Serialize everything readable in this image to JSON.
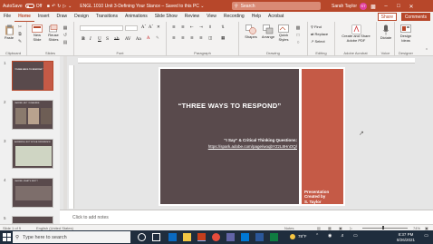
{
  "titlebar": {
    "autosave_label": "AutoSave",
    "autosave_state": "Off",
    "doc_title": "ENGL 1010 Unit 3-Defining Your Stance – Saved to this PC ⌄",
    "search_placeholder": "Search",
    "user_name": "Sarah Taylor",
    "user_initials": "ST",
    "accent_color": "#b7472a"
  },
  "tabs": [
    "File",
    "Home",
    "Insert",
    "Draw",
    "Design",
    "Transitions",
    "Animations",
    "Slide Show",
    "Review",
    "View",
    "Recording",
    "Help",
    "Acrobat"
  ],
  "active_tab": "Home",
  "share_label": "Share",
  "comments_label": "Comments",
  "ribbon": {
    "clipboard": {
      "paste": "Paste",
      "label": "Clipboard"
    },
    "slides": {
      "new_slide": "New Slide",
      "reuse_slides": "Reuse Slides",
      "label": "Slides"
    },
    "font": {
      "label": "Font",
      "buttons": [
        "B",
        "I",
        "U",
        "S",
        "ab",
        "AV",
        "Aa"
      ]
    },
    "paragraph": {
      "label": "Paragraph"
    },
    "drawing": {
      "shapes": "Shapes",
      "arrange": "Arrange",
      "quick_styles": "Quick Styles",
      "label": "Drawing"
    },
    "editing": {
      "find": "Find",
      "replace": "Replace",
      "select": "Select",
      "label": "Editing"
    },
    "adobe": {
      "create_share": "Create and Share Adobe PDF",
      "label": "Adobe Acrobat"
    },
    "voice": {
      "dictate": "Dictate",
      "label": "Voice"
    },
    "designer": {
      "design_ideas": "Design Ideas",
      "label": "Designer"
    }
  },
  "thumbnails": [
    {
      "num": "1",
      "title": "“THREE WAYS TO RESPOND”"
    },
    {
      "num": "2",
      "title": "I AGREE, BUT I DISAGREE"
    },
    {
      "num": "3",
      "title": "AGREEING, BUT WITH A DIFFERENCE"
    },
    {
      "num": "4",
      "title": "I AGREE, WHAT'S NEXT?"
    },
    {
      "num": "5",
      "title": ""
    }
  ],
  "slide": {
    "title": "“THREE WAYS TO RESPOND”",
    "subtitle": "“I Say” & Critical Thinking Questions:",
    "link": "https://spark.adobe.com/page/woqbYZzL8HnOQ/",
    "credit_line1": "Presentation",
    "credit_line2": "Created by",
    "credit_line3": "S. Taylor",
    "dark_color": "#594a4c",
    "accent_color": "#c55a46"
  },
  "notes_placeholder": "Click to add notes",
  "statusbar": {
    "slide_count": "Slide 1 of 9",
    "language": "English (United States)",
    "notes": "Notes",
    "zoom": "74%"
  },
  "taskbar": {
    "search_placeholder": "Type here to search",
    "weather": "78°F",
    "time": "8:37 PM",
    "date": "8/26/2021"
  }
}
